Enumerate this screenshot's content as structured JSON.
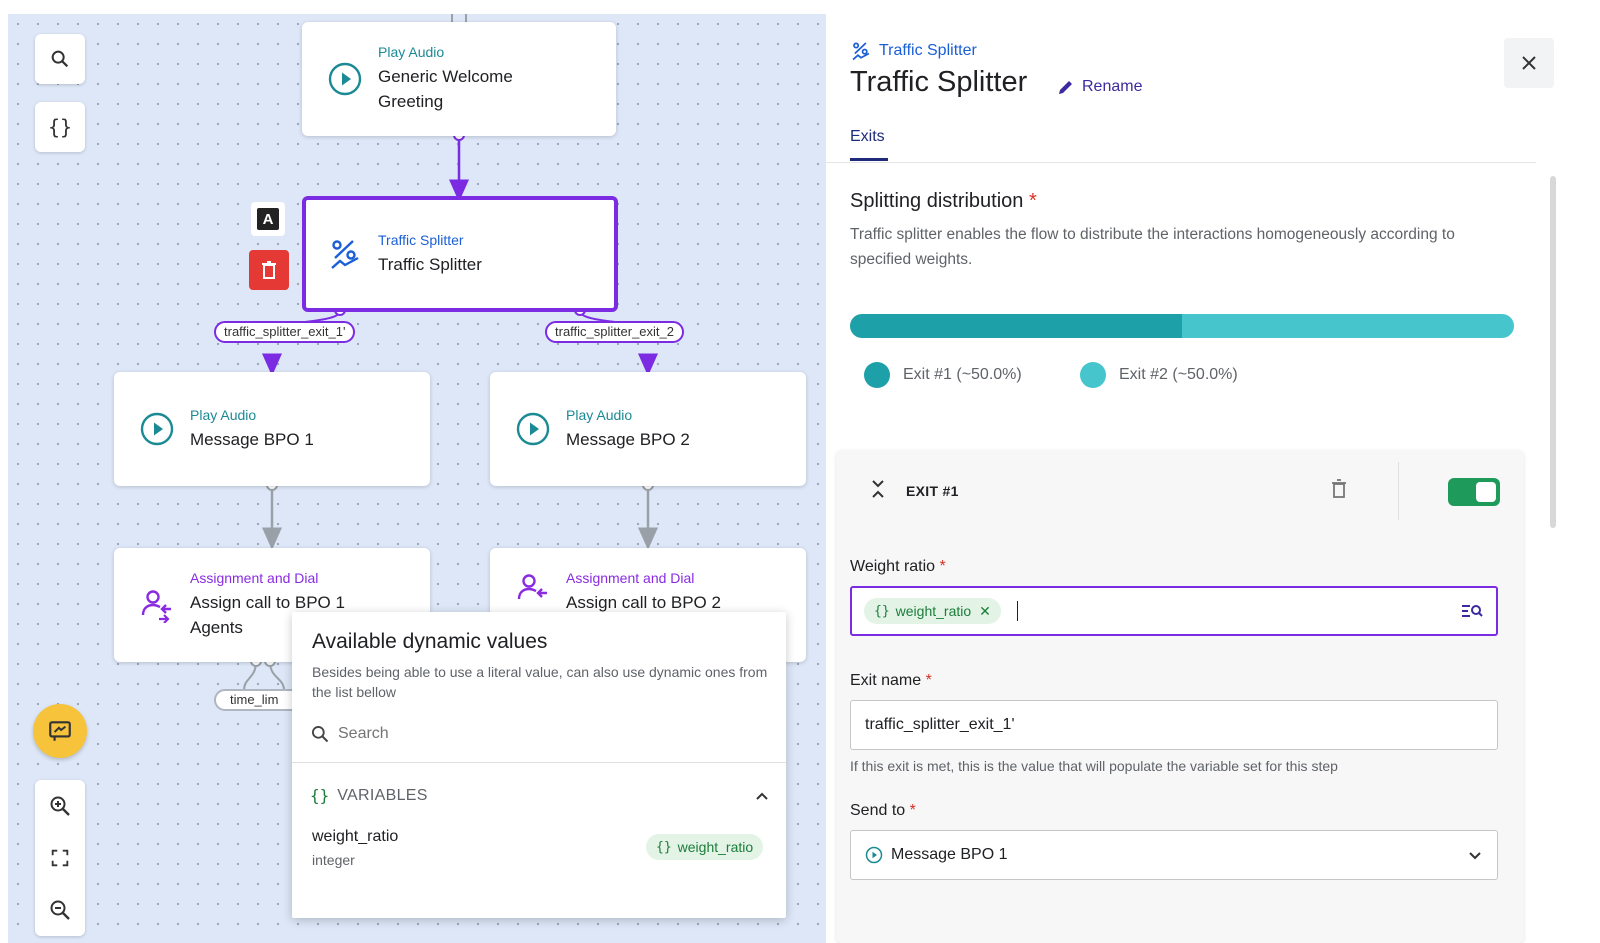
{
  "canvas": {
    "nodes": {
      "welcome": {
        "type": "Play Audio",
        "name_line1": "Generic Welcome",
        "name_line2": "Greeting"
      },
      "splitter": {
        "type": "Traffic Splitter",
        "name": "Traffic Splitter"
      },
      "bpo1": {
        "type": "Play Audio",
        "name": "Message BPO 1"
      },
      "bpo2": {
        "type": "Play Audio",
        "name": "Message BPO 2"
      },
      "assign1": {
        "type": "Assignment and Dial",
        "name_line1": "Assign call to BPO 1",
        "name_line2": "Agents"
      },
      "assign2": {
        "type": "Assignment and Dial",
        "name": "Assign call to BPO 2"
      }
    },
    "exits": {
      "exit1": "traffic_splitter_exit_1'",
      "exit2": "traffic_splitter_exit_2"
    },
    "time_pill": "time_lim",
    "node_action_label": "A",
    "variables_tool_label": "{}"
  },
  "popup": {
    "title": "Available dynamic values",
    "description": "Besides being able to use a literal value, can also use dynamic ones from the list bellow",
    "search_placeholder": "Search",
    "section_label": "VARIABLES",
    "section_icon": "{}",
    "variable": {
      "name": "weight_ratio",
      "type": "integer",
      "chip": "weight_ratio"
    }
  },
  "panel": {
    "breadcrumb": "Traffic Splitter",
    "title": "Traffic Splitter",
    "rename_label": "Rename",
    "tab": "Exits",
    "section_title": "Splitting distribution",
    "section_description": "Traffic splitter enables the flow to distribute the interactions homogeneously according to specified weights.",
    "distribution": [
      {
        "label": "Exit #1 (~50.0%)",
        "share": 0.5,
        "color": "#1ea0a8"
      },
      {
        "label": "Exit #2 (~50.0%)",
        "share": 0.5,
        "color": "#46c5cc"
      }
    ],
    "exit_card": {
      "label": "EXIT #1",
      "enabled": true,
      "weight_label": "Weight ratio",
      "weight_chip": "weight_ratio",
      "exit_name_label": "Exit name",
      "exit_name_value": "traffic_splitter_exit_1'",
      "exit_name_helper": "If this exit is met, this is the value that will populate the variable set for this step",
      "send_to_label": "Send to",
      "send_to_value": "Message BPO 1"
    }
  },
  "required_mark": "*",
  "colors": {
    "accent": "#7b2be2",
    "teal": "#1ea0a8",
    "toggle_on": "#1e9a5a",
    "delete": "#e53935",
    "fab": "#f6c33a"
  }
}
